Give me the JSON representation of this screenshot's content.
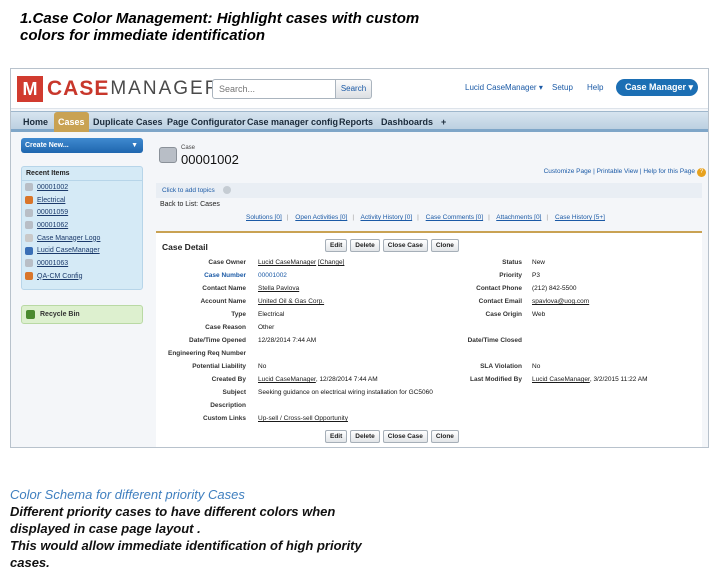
{
  "heading": {
    "line1": "1.Case Color Management: Highlight cases with custom",
    "line2": "colors for immediate identification"
  },
  "topbar": {
    "logo_case": "CASE",
    "logo_manager": "MANAGER",
    "search_placeholder": "Search...",
    "search_button": "Search",
    "user_menu": "Lucid CaseManager ▾",
    "setup": "Setup",
    "help": "Help",
    "app_button": "Case Manager ▾"
  },
  "tabs": [
    "Home",
    "Cases",
    "Duplicate Cases",
    "Page Configurator",
    "Case manager config",
    "Reports",
    "Dashboards",
    "+"
  ],
  "sidebar": {
    "create_new": "Create New...",
    "recent_title": "Recent Items",
    "recent_items": [
      {
        "label": "00001002",
        "icon": "case-icon",
        "color": "#b8bec6"
      },
      {
        "label": "Electrical",
        "icon": "solution-icon",
        "color": "#d9762b"
      },
      {
        "label": "00001059",
        "icon": "case-icon",
        "color": "#b8bec6"
      },
      {
        "label": "00001062",
        "icon": "case-icon",
        "color": "#b8bec6"
      },
      {
        "label": "Case Manager Logo",
        "icon": "document-icon",
        "color": "#c9c9c9"
      },
      {
        "label": "Lucid CaseManager",
        "icon": "user-icon",
        "color": "#3a6fb6"
      },
      {
        "label": "00001063",
        "icon": "case-icon",
        "color": "#b8bec6"
      },
      {
        "label": "QA-CM Config",
        "icon": "config-icon",
        "color": "#d9762b"
      }
    ],
    "recycle_bin": "Recycle Bin"
  },
  "record": {
    "object_label": "Case",
    "number": "00001002",
    "top_links": "Customize Page | Printable View | Help for this Page",
    "topics": "Click to add topics",
    "back": "Back to List: Cases",
    "related_links": [
      "Solutions [0]",
      "Open Activities [0]",
      "Activity History [0]",
      "Case Comments [0]",
      "Attachments [0]",
      "Case History [5+]"
    ],
    "detail_title": "Case Detail",
    "buttons": [
      "Edit",
      "Delete",
      "Close Case",
      "Clone"
    ]
  },
  "fields": {
    "case_owner_label": "Case Owner",
    "case_owner": "Lucid CaseManager",
    "change": "[Change]",
    "status_label": "Status",
    "status": "New",
    "case_number_label": "Case Number",
    "case_number": "00001002",
    "priority_label": "Priority",
    "priority": "P3",
    "contact_name_label": "Contact Name",
    "contact_name": "Stella Pavlova",
    "contact_phone_label": "Contact Phone",
    "contact_phone": "(212) 842-5500",
    "account_name_label": "Account Name",
    "account_name": "United Oil & Gas Corp.",
    "contact_email_label": "Contact Email",
    "contact_email": "spavlova@uog.com",
    "type_label": "Type",
    "type": "Electrical",
    "case_origin_label": "Case Origin",
    "case_origin": "Web",
    "case_reason_label": "Case Reason",
    "case_reason": "Other",
    "date_opened_label": "Date/Time Opened",
    "date_opened": "12/28/2014 7:44 AM",
    "date_closed_label": "Date/Time Closed",
    "eng_req_label": "Engineering Req Number",
    "potential_liability_label": "Potential Liability",
    "potential_liability": "No",
    "sla_violation_label": "SLA Violation",
    "sla_violation": "No",
    "created_by_label": "Created By",
    "created_by": "Lucid CaseManager",
    "created_date": ", 12/28/2014 7:44 AM",
    "last_modified_label": "Last Modified By",
    "last_modified_by": "Lucid CaseManager",
    "last_modified_date": ", 3/2/2015 11:22 AM",
    "subject_label": "Subject",
    "subject": "Seeking guidance on electrical wiring installation for GC5060",
    "description_label": "Description",
    "custom_links_label": "Custom Links",
    "custom_links": "Up-sell / Cross-sell Opportunity"
  },
  "footer": {
    "title": "Color Schema for different priority Cases",
    "line1": "Different priority cases to have different colors when",
    "line2": "displayed in case page layout .",
    "line3": "This would allow immediate identification of high priority",
    "line4": "cases."
  },
  "colors": {
    "accent": "#c9a253",
    "brand": "#c8372b",
    "link": "#1b5aa6"
  }
}
